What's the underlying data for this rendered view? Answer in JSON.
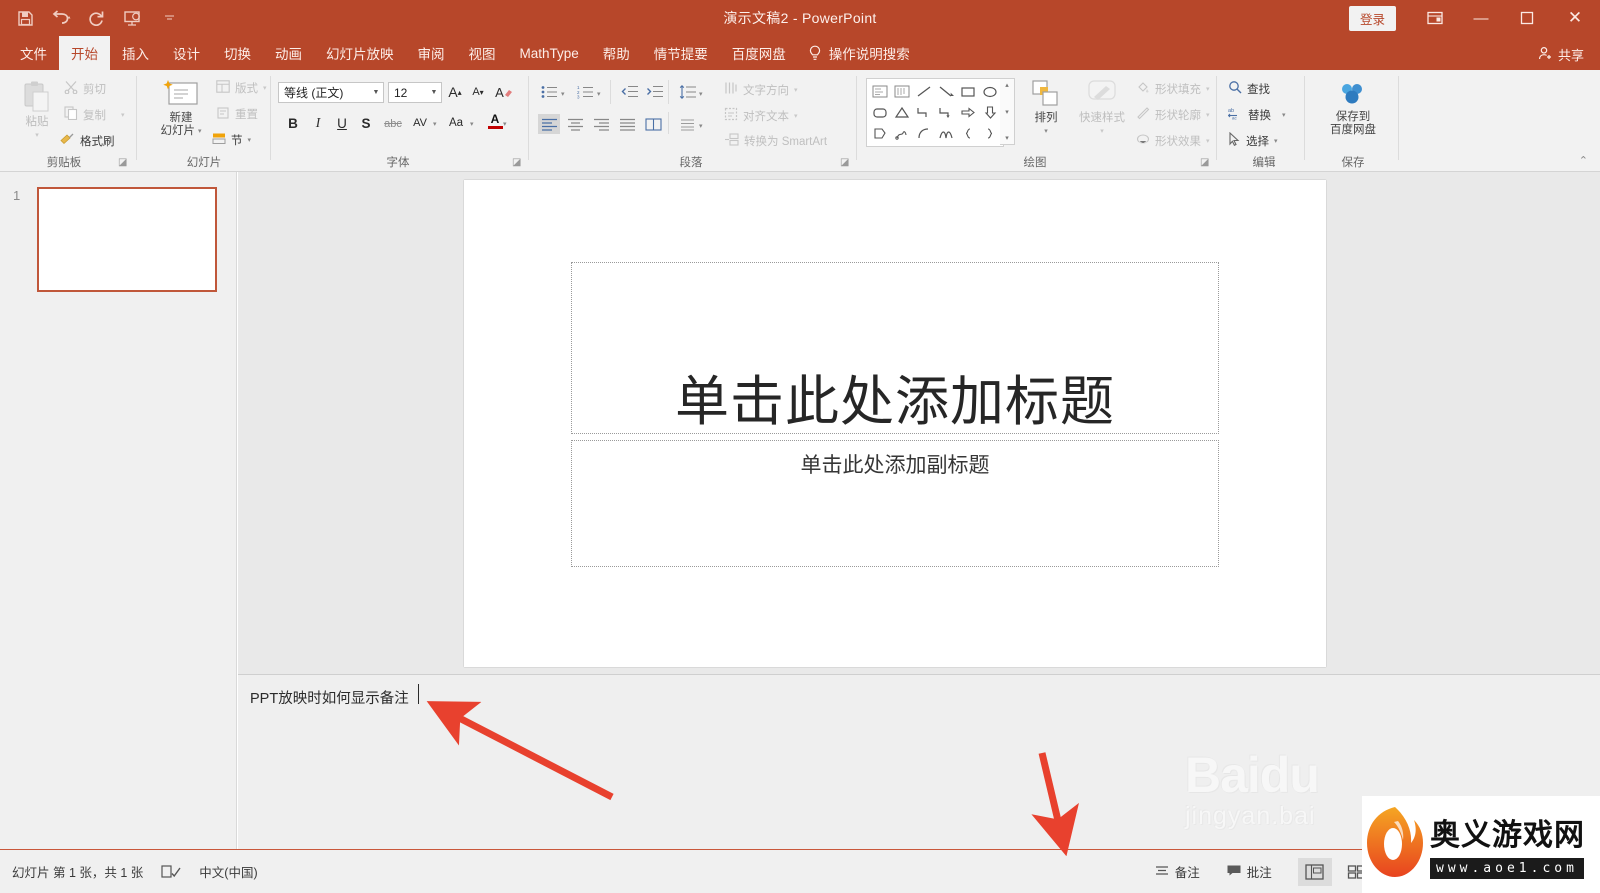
{
  "window": {
    "title": "演示文稿2  -  PowerPoint",
    "signin_label": "登录",
    "ribbon_display_icon": "ribbon-display-options-icon",
    "minimize_label": "—",
    "maximize_label": "❐",
    "close_label": "✕",
    "accent_color": "#b7472a"
  },
  "quick_access": [
    {
      "name": "save-icon",
      "glyph": "save"
    },
    {
      "name": "undo-icon",
      "glyph": "undo"
    },
    {
      "name": "redo-icon",
      "glyph": "redo"
    },
    {
      "name": "start-from-beginning-icon",
      "glyph": "slideshow"
    },
    {
      "name": "customize-qat-icon",
      "glyph": "chevron-down"
    }
  ],
  "tabs": [
    {
      "label": "文件",
      "active": false
    },
    {
      "label": "开始",
      "active": true
    },
    {
      "label": "插入",
      "active": false
    },
    {
      "label": "设计",
      "active": false
    },
    {
      "label": "切换",
      "active": false
    },
    {
      "label": "动画",
      "active": false
    },
    {
      "label": "幻灯片放映",
      "active": false
    },
    {
      "label": "审阅",
      "active": false
    },
    {
      "label": "视图",
      "active": false
    },
    {
      "label": "MathType",
      "active": false
    },
    {
      "label": "帮助",
      "active": false
    },
    {
      "label": "情节提要",
      "active": false
    },
    {
      "label": "百度网盘",
      "active": false
    }
  ],
  "tell_me": "操作说明搜索",
  "share_label": "共享",
  "ribbon": {
    "groups": [
      {
        "key": "clipboard",
        "label": "剪贴板"
      },
      {
        "key": "slides",
        "label": "幻灯片"
      },
      {
        "key": "font",
        "label": "字体"
      },
      {
        "key": "paragraph",
        "label": "段落"
      },
      {
        "key": "drawing",
        "label": "绘图"
      },
      {
        "key": "editing",
        "label": "编辑"
      },
      {
        "key": "save",
        "label": "保存"
      }
    ],
    "clipboard": {
      "paste_label": "粘贴",
      "cut_label": "剪切",
      "copy_label": "复制",
      "format_painter_label": "格式刷"
    },
    "slides": {
      "new_slide_line1": "新建",
      "new_slide_line2": "幻灯片",
      "layout_label": "版式",
      "reset_label": "重置",
      "section_label": "节"
    },
    "font": {
      "font_name": "等线 (正文)",
      "font_size": "12",
      "grow_label": "A",
      "shrink_label": "A",
      "clear_format_label": "A",
      "bold_label": "B",
      "italic_label": "I",
      "underline_label": "U",
      "shadow_label": "S",
      "strike_label": "abc",
      "spacing_label": "AV",
      "case_label": "Aa",
      "font_color_label": "A"
    },
    "paragraph": {
      "text_direction_label": "文字方向",
      "align_text_label": "对齐文本",
      "smartart_label": "转换为 SmartArt"
    },
    "drawing": {
      "arrange_label": "排列",
      "quick_styles_line1": "快速样式",
      "shape_fill_label": "形状填充",
      "shape_outline_label": "形状轮廓",
      "shape_effects_label": "形状效果"
    },
    "editing": {
      "find_label": "查找",
      "replace_label": "替换",
      "select_label": "选择"
    },
    "save_group": {
      "save_line1": "保存到",
      "save_line2": "百度网盘"
    }
  },
  "thumbnails": [
    {
      "number": "1"
    }
  ],
  "slide": {
    "title_placeholder": "单击此处添加标题",
    "subtitle_placeholder": "单击此处添加副标题"
  },
  "notes": {
    "text": "PPT放映时如何显示备注"
  },
  "status_bar": {
    "slide_count_text": "幻灯片 第 1 张，共 1 张",
    "spellcheck_icon": "spellcheck-icon",
    "language": "中文(中国)",
    "notes_button": "备注",
    "comments_button": "批注",
    "views": [
      {
        "name": "normal-view",
        "active": true
      },
      {
        "name": "slide-sorter-view",
        "active": false
      },
      {
        "name": "reading-view",
        "active": false
      },
      {
        "name": "slideshow-view",
        "active": false
      }
    ],
    "zoom_out": "—",
    "zoom_in": "+"
  },
  "watermarks": {
    "baidu_line1": "Baidu",
    "baidu_line2": "jingyan.bai",
    "aoel_name": "奥义游戏网",
    "aoel_url": "www.aoe1.com"
  }
}
